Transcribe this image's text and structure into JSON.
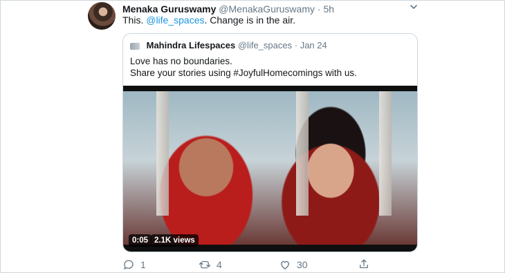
{
  "tweet": {
    "display_name": "Menaka Guruswamy",
    "handle": "@MenakaGuruswamy",
    "separator": "·",
    "time": "5h",
    "text_prefix": "This. ",
    "text_mention": "@life_spaces",
    "text_suffix": ". Change is in the air."
  },
  "quoted": {
    "display_name": "Mahindra Lifespaces",
    "handle": "@life_spaces",
    "separator": "·",
    "date": "Jan 24",
    "text": "Love has no boundaries.\nShare your stories using #JoyfulHomecomings with us.",
    "video": {
      "duration": "0:05",
      "views": "2.1K views"
    }
  },
  "actions": {
    "reply_count": "1",
    "retweet_count": "4",
    "like_count": "30"
  },
  "icons": {
    "reply": "reply-icon",
    "retweet": "retweet-icon",
    "like": "heart-icon",
    "share": "share-icon",
    "menu": "chevron-down-icon"
  },
  "colors": {
    "link": "#1b95e0",
    "muted": "#657786",
    "border": "#ccd6dd"
  }
}
